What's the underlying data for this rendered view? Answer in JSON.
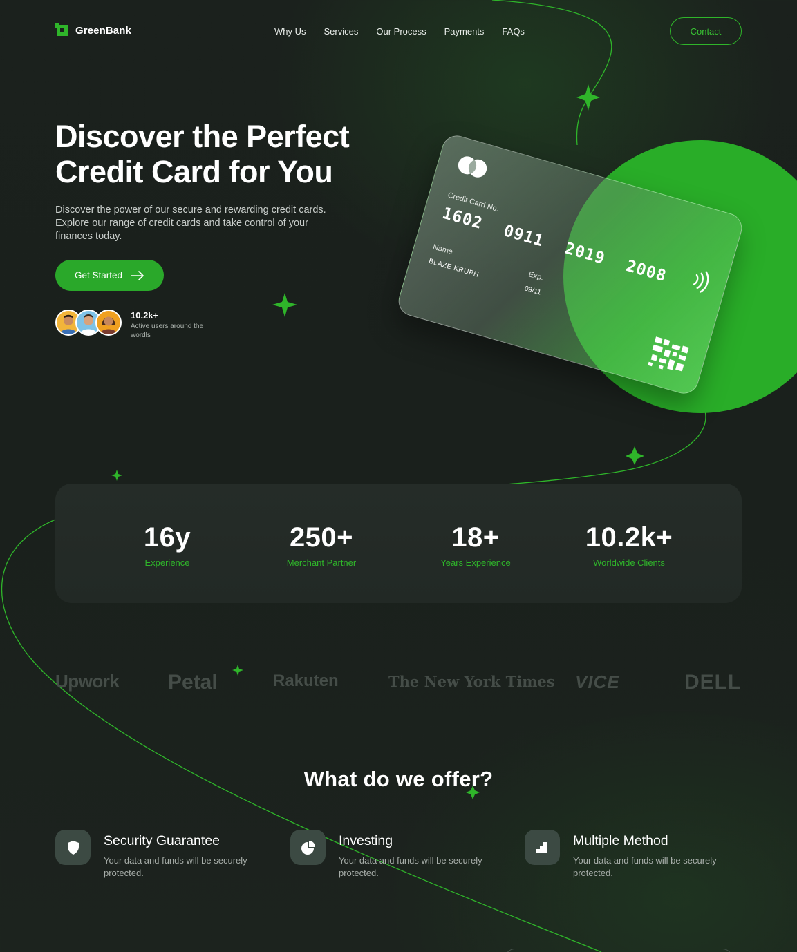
{
  "nav": {
    "brand": "GreenBank",
    "items": [
      "Why Us",
      "Services",
      "Our Process",
      "Payments",
      "FAQs"
    ],
    "contact_label": "Contact"
  },
  "hero": {
    "title_line1": "Discover the Perfect",
    "title_line2": "Credit Card for You",
    "description": "Discover the power of our secure and rewarding credit cards. Explore our range of credit cards and take control of your finances today.",
    "cta_label": "Get Started",
    "users_count": "10.2k+",
    "users_label": "Active users around the wordls"
  },
  "card": {
    "number_label": "Credit Card No.",
    "number": "1602 0911 2019 2008",
    "name_label": "Name",
    "name": "BLAZE KRUPH",
    "exp_label": "Exp.",
    "exp": "09/11"
  },
  "stats": [
    {
      "value": "16y",
      "label": "Experience"
    },
    {
      "value": "250+",
      "label": "Merchant Partner"
    },
    {
      "value": "18+",
      "label": "Years Experience"
    },
    {
      "value": "10.2k+",
      "label": "Worldwide Clients"
    }
  ],
  "brands": [
    "Upwork",
    "Petal",
    "Rakuten",
    "The New York Times",
    "VICE",
    "DELL"
  ],
  "offers": {
    "title": "What do we offer?",
    "items": [
      {
        "title": "Security Guarantee",
        "description": "Your data and funds will be securely protected.",
        "icon": "shield-icon"
      },
      {
        "title": "Investing",
        "description": "Your data and funds will be securely protected.",
        "icon": "pie-chart-icon"
      },
      {
        "title": "Multiple Method",
        "description": "Your data and funds will be securely protected.",
        "icon": "bar-chart-icon"
      }
    ]
  },
  "colors": {
    "accent": "#2aa82a",
    "background": "#1b211d",
    "stat_label": "#2fb52a"
  }
}
